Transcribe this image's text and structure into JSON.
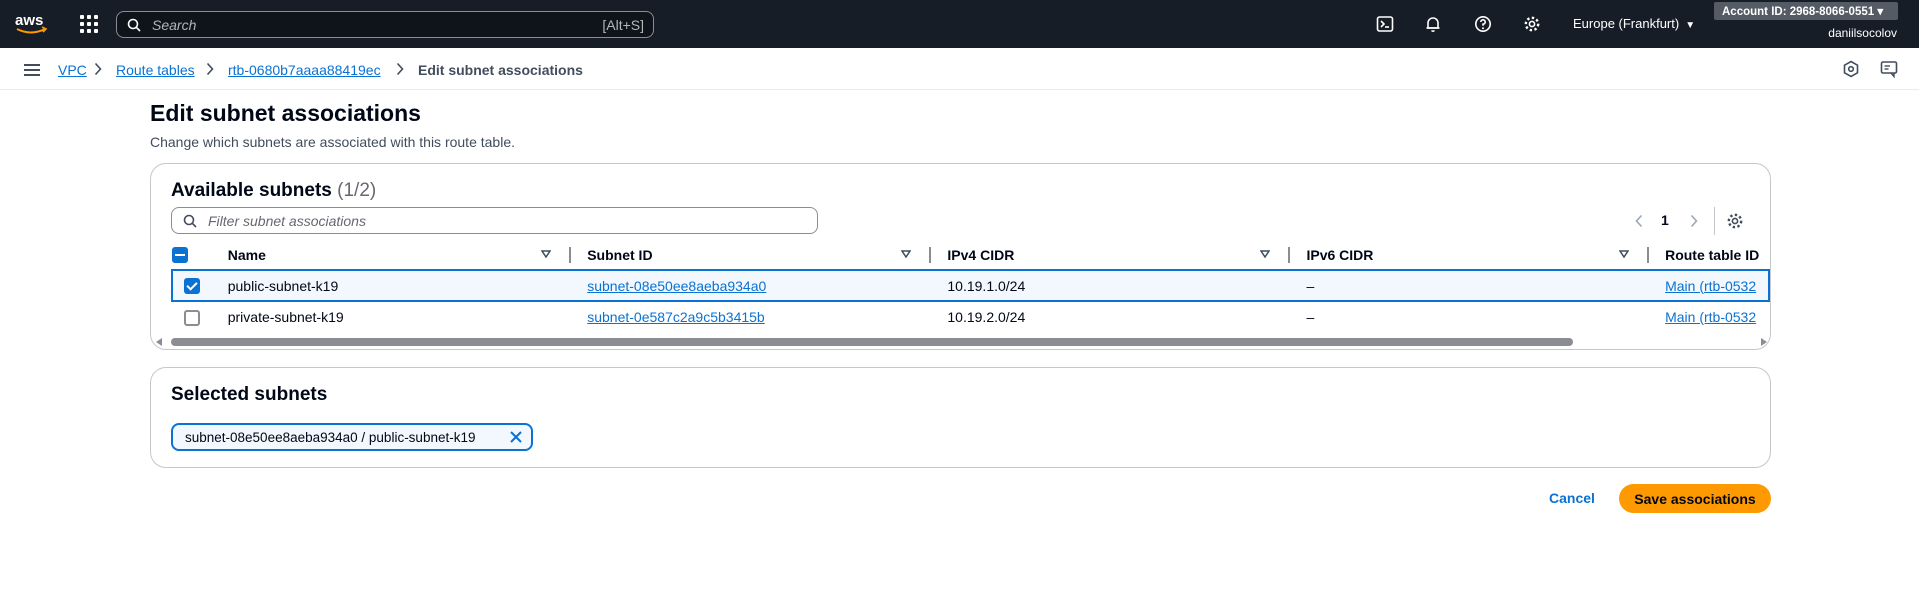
{
  "topnav": {
    "search_placeholder": "Search",
    "search_shortcut": "[Alt+S]",
    "region": "Europe (Frankfurt)",
    "account": "Account ID: 2968-8066-0551 ▾",
    "user": "daniilsocolov"
  },
  "breadcrumb": {
    "items": [
      "VPC",
      "Route tables",
      "rtb-0680b7aaaa88419ec"
    ],
    "current": "Edit subnet associations"
  },
  "page": {
    "title": "Edit subnet associations",
    "description": "Change which subnets are associated with this route table."
  },
  "available": {
    "title": "Available subnets",
    "count": "(1/2)",
    "filter_placeholder": "Filter subnet associations",
    "page": "1",
    "columns": [
      "Name",
      "Subnet ID",
      "IPv4 CIDR",
      "IPv6 CIDR",
      "Route table ID"
    ],
    "rows": [
      {
        "selected": true,
        "name": "public-subnet-k19",
        "subnet_id": "subnet-08e50ee8aeba934a0",
        "ipv4": "10.19.1.0/24",
        "ipv6": "–",
        "route_table": "Main (rtb-0532"
      },
      {
        "selected": false,
        "name": "private-subnet-k19",
        "subnet_id": "subnet-0e587c2a9c5b3415b",
        "ipv4": "10.19.2.0/24",
        "ipv6": "–",
        "route_table": "Main (rtb-0532"
      }
    ]
  },
  "selected": {
    "title": "Selected subnets",
    "tokens": [
      "subnet-08e50ee8aeba934a0 / public-subnet-k19"
    ]
  },
  "actions": {
    "cancel": "Cancel",
    "save": "Save associations"
  },
  "colors": {
    "nav_bg": "#161d26",
    "link": "#0972d3",
    "primary_button": "#ff9900"
  }
}
